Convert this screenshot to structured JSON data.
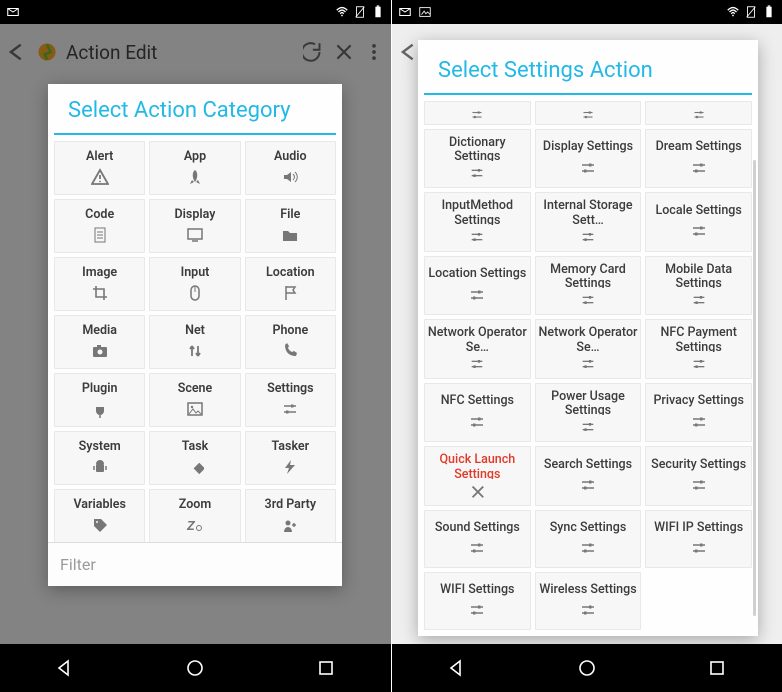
{
  "statusbar": {
    "icons_left": [
      "mail-icon",
      "photo-icon"
    ],
    "icons_right": [
      "wifi-icon",
      "no-sim-icon",
      "battery-icon"
    ]
  },
  "left": {
    "toolbar": {
      "back_label": "",
      "app_icon": "tasker-icon",
      "title": "Action Edit",
      "refresh": "",
      "close": "",
      "overflow": ""
    },
    "dialog": {
      "title": "Select Action Category",
      "filter_placeholder": "Filter",
      "categories": [
        {
          "label": "Alert",
          "icon": "alert-icon"
        },
        {
          "label": "App",
          "icon": "rocket-icon"
        },
        {
          "label": "Audio",
          "icon": "speaker-icon"
        },
        {
          "label": "Code",
          "icon": "doc-icon"
        },
        {
          "label": "Display",
          "icon": "monitor-icon"
        },
        {
          "label": "File",
          "icon": "folder-icon"
        },
        {
          "label": "Image",
          "icon": "crop-icon"
        },
        {
          "label": "Input",
          "icon": "mouse-icon"
        },
        {
          "label": "Location",
          "icon": "flag-icon"
        },
        {
          "label": "Media",
          "icon": "camera-icon"
        },
        {
          "label": "Net",
          "icon": "updown-icon"
        },
        {
          "label": "Phone",
          "icon": "phone-icon"
        },
        {
          "label": "Plugin",
          "icon": "plug-icon"
        },
        {
          "label": "Scene",
          "icon": "picture-icon"
        },
        {
          "label": "Settings",
          "icon": "sliders-icon"
        },
        {
          "label": "System",
          "icon": "android-icon"
        },
        {
          "label": "Task",
          "icon": "diamond-icon"
        },
        {
          "label": "Tasker",
          "icon": "bolt-icon"
        },
        {
          "label": "Variables",
          "icon": "tag-icon"
        },
        {
          "label": "Zoom",
          "icon": "zoom-icon"
        },
        {
          "label": "3rd Party",
          "icon": "group-icon"
        }
      ]
    }
  },
  "right": {
    "toolbar": {
      "title_prefix": "A"
    },
    "dialog": {
      "title": "Select Settings Action",
      "actions": [
        {
          "label": "",
          "icon": "sliders-icon",
          "stub": true
        },
        {
          "label": "",
          "icon": "sliders-icon",
          "stub": true
        },
        {
          "label": "",
          "icon": "sliders-icon",
          "stub": true
        },
        {
          "label": "Dictionary Settings",
          "icon": "sliders-icon"
        },
        {
          "label": "Display Settings",
          "icon": "sliders-icon"
        },
        {
          "label": "Dream Settings",
          "icon": "sliders-icon"
        },
        {
          "label": "InputMethod Settings",
          "icon": "sliders-icon"
        },
        {
          "label": "Internal Storage Sett…",
          "icon": "sliders-icon"
        },
        {
          "label": "Locale Settings",
          "icon": "sliders-icon"
        },
        {
          "label": "Location Settings",
          "icon": "sliders-icon"
        },
        {
          "label": "Memory Card Settings",
          "icon": "sliders-icon"
        },
        {
          "label": "Mobile Data Settings",
          "icon": "sliders-icon"
        },
        {
          "label": "Network Operator Se…",
          "icon": "sliders-icon"
        },
        {
          "label": "Network Operator Se…",
          "icon": "sliders-icon"
        },
        {
          "label": "NFC Payment Settings",
          "icon": "sliders-icon"
        },
        {
          "label": "NFC Settings",
          "icon": "sliders-icon"
        },
        {
          "label": "Power Usage Settings",
          "icon": "sliders-icon"
        },
        {
          "label": "Privacy Settings",
          "icon": "sliders-icon"
        },
        {
          "label": "Quick Launch Settings",
          "icon": "close-icon",
          "highlight": true
        },
        {
          "label": "Search Settings",
          "icon": "sliders-icon"
        },
        {
          "label": "Security Settings",
          "icon": "sliders-icon"
        },
        {
          "label": "Sound Settings",
          "icon": "sliders-icon"
        },
        {
          "label": "Sync Settings",
          "icon": "sliders-icon"
        },
        {
          "label": "WIFI IP Settings",
          "icon": "sliders-icon"
        },
        {
          "label": "WIFI Settings",
          "icon": "sliders-icon"
        },
        {
          "label": "Wireless Settings",
          "icon": "sliders-icon"
        },
        {
          "label": "",
          "icon": "",
          "empty": true
        }
      ]
    }
  },
  "navbar": {
    "back": "",
    "home": "",
    "recents": ""
  }
}
